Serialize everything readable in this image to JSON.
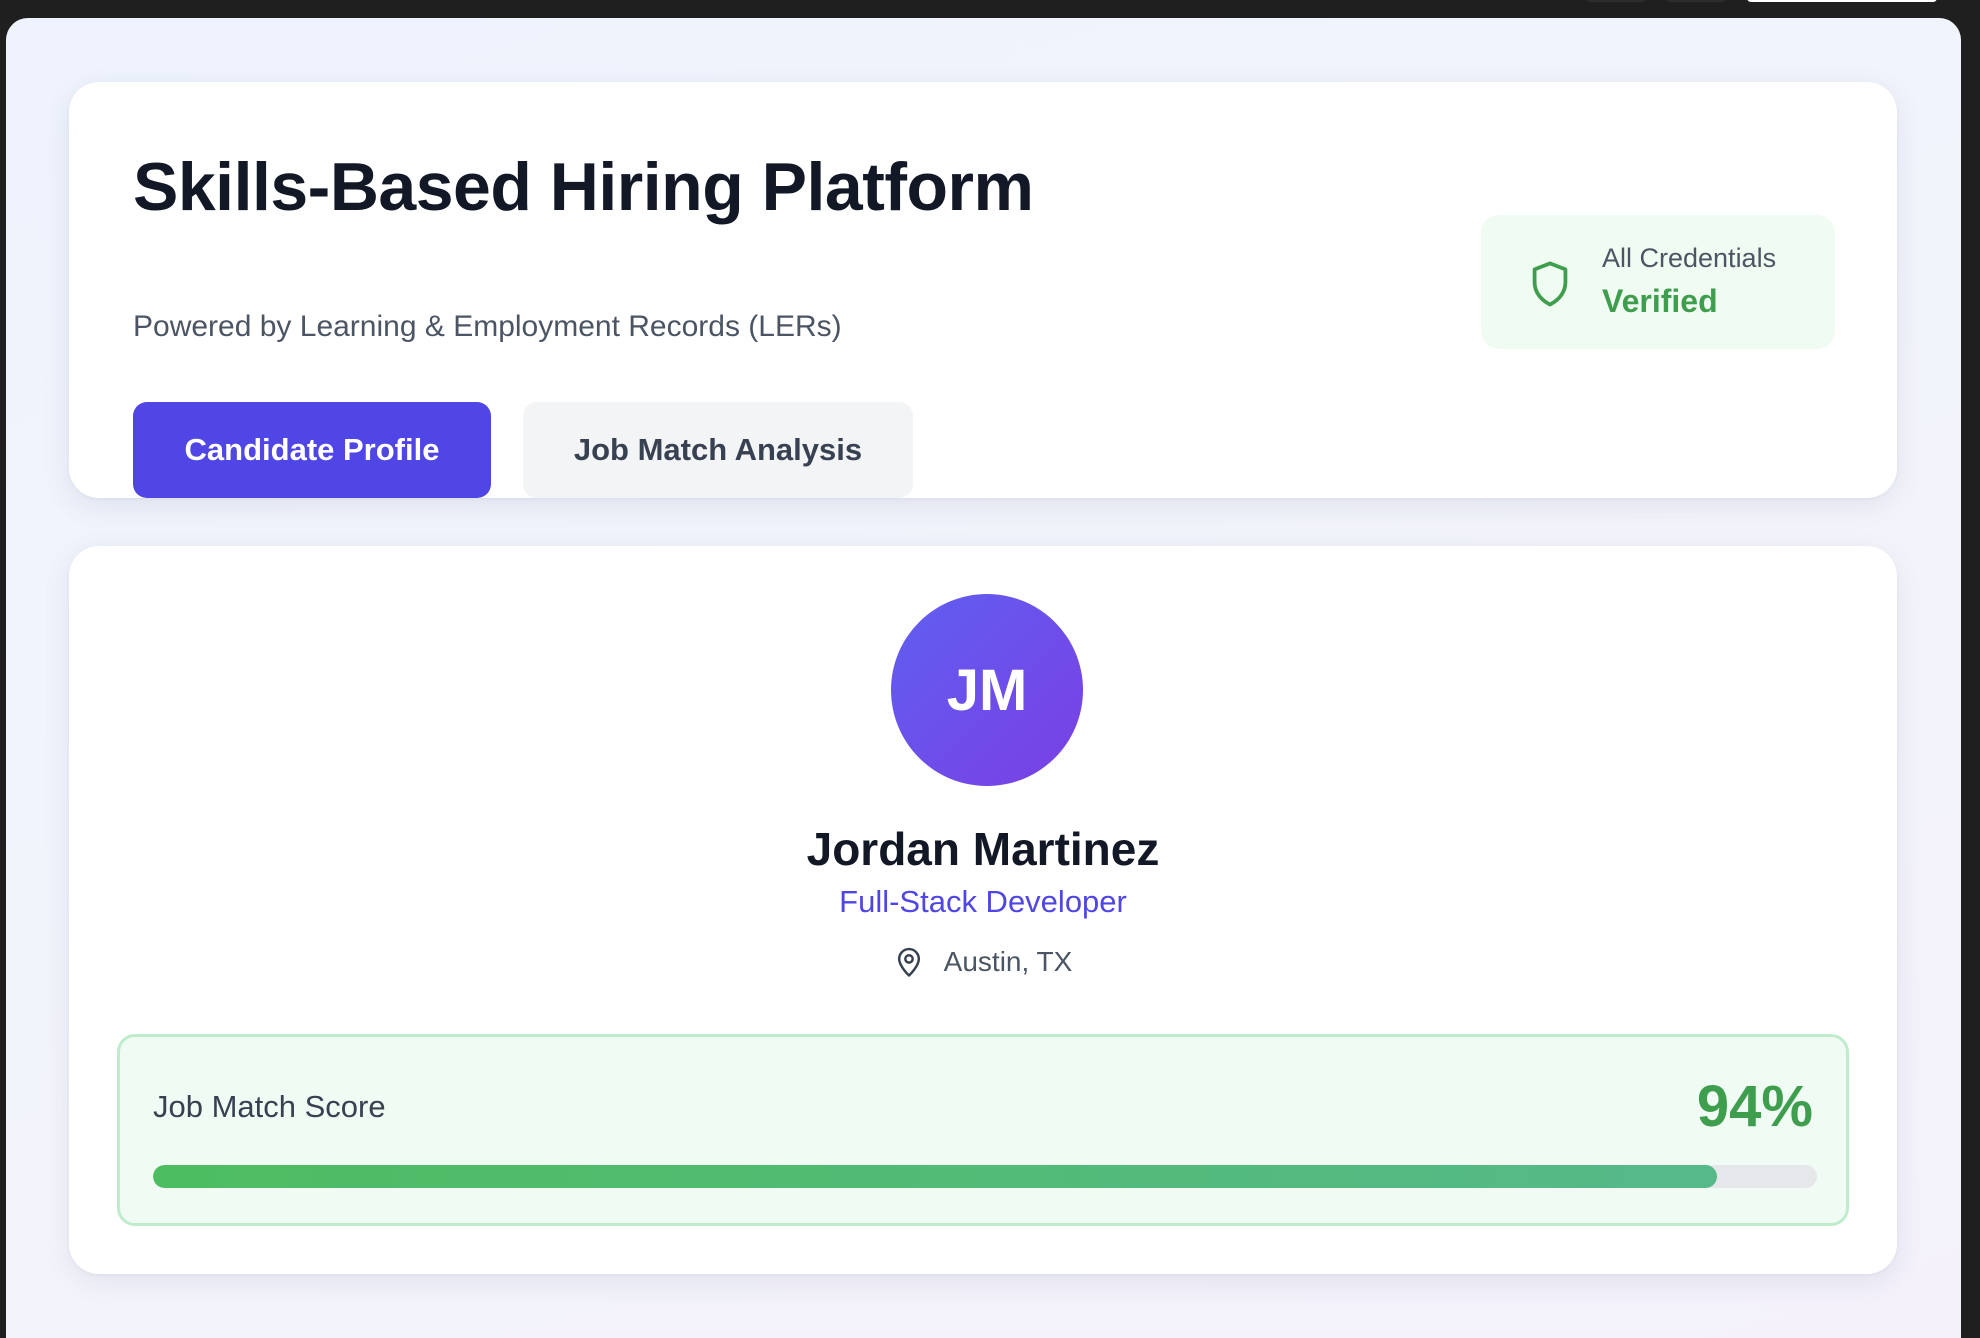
{
  "header": {
    "title": "Skills-Based Hiring Platform",
    "subtitle": "Powered by Learning & Employment Records (LERs)",
    "credentials": {
      "icon": "shield-icon",
      "label": "All Credentials",
      "status": "Verified",
      "status_color": "#3f9e4e"
    },
    "tabs": [
      {
        "label": "Candidate Profile",
        "active": true
      },
      {
        "label": "Job Match Analysis",
        "active": false
      }
    ]
  },
  "candidate": {
    "initials": "JM",
    "name": "Jordan Martinez",
    "role": "Full-Stack Developer",
    "location": "Austin, TX",
    "location_icon": "map-pin-icon"
  },
  "match": {
    "label": "Job Match Score",
    "score_text": "94%",
    "score_fraction": 0.94
  },
  "colors": {
    "accent": "#4f46e5",
    "success": "#3f9e4e",
    "avatar_gradient_start": "#5f5ff0",
    "avatar_gradient_end": "#7b3fe4"
  }
}
